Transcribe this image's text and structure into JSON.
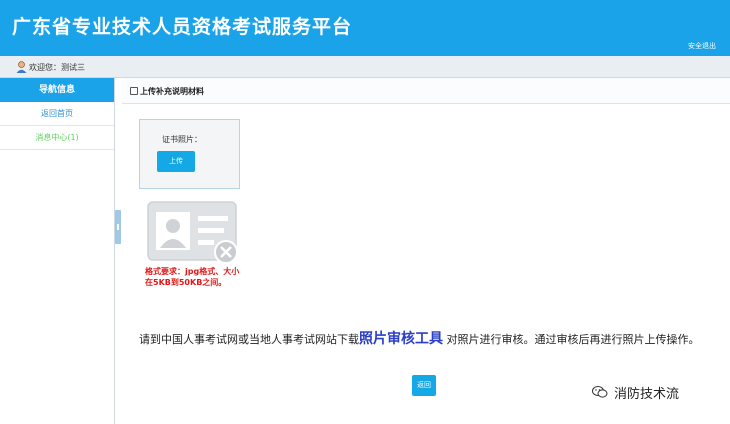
{
  "header": {
    "site_title": "广东省专业技术人员资格考试服务平台",
    "logout_label": "安全退出"
  },
  "userbar": {
    "welcome_text": "欢迎您：测试三"
  },
  "sidebar": {
    "heading": "导航信息",
    "items": [
      {
        "label": "返回首页"
      },
      {
        "label": "消息中心(1)"
      }
    ]
  },
  "main": {
    "title": "上传补充说明材料",
    "cert_label": "证书照片：",
    "upload_label": "上传",
    "format_note": "格式要求：jpg格式、大小在5KB到50KB之间。",
    "instruction_before": "请到中国人事考试网或当地人事考试网站下载",
    "instruction_link": "照片审核工具",
    "instruction_after": " 对照片进行审核。通过审核后再进行照片上传操作。",
    "back_label": "返回"
  },
  "watermark": {
    "text": "消防技术流"
  },
  "colors": {
    "primary": "#1aa3e8",
    "button": "#14a9e6",
    "warning": "#e01818",
    "link": "#2b3fc8",
    "nav_active": "#5bd15b"
  }
}
